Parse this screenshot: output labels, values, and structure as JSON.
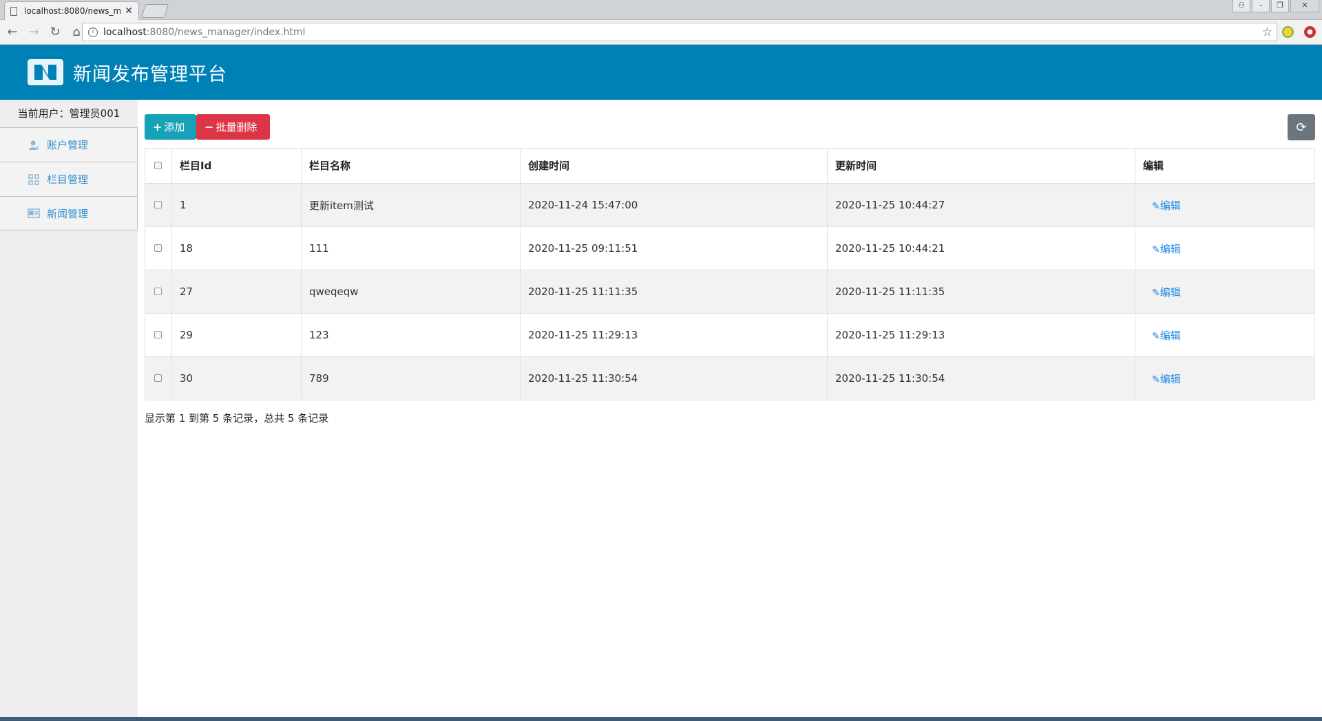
{
  "browser": {
    "tab_title": "localhost:8080/news_m",
    "url_host": "localhost",
    "url_path": ":8080/news_manager/index.html"
  },
  "app": {
    "title": "新闻发布管理平台",
    "brand_color": "#0081b6"
  },
  "sidebar": {
    "current_user": "当前用户：管理员001",
    "items": [
      {
        "label": "账户管理",
        "icon": "user-icon"
      },
      {
        "label": "栏目管理",
        "icon": "grid-icon"
      },
      {
        "label": "新闻管理",
        "icon": "news-icon"
      }
    ]
  },
  "toolbar": {
    "add_label": "添加",
    "batch_delete_label": "批量删除"
  },
  "table": {
    "headers": [
      "栏目Id",
      "栏目名称",
      "创建时间",
      "更新时间",
      "编辑"
    ],
    "edit_label": "编辑",
    "rows": [
      {
        "id": "1",
        "name": "更新item测试",
        "created": "2020-11-24 15:47:00",
        "updated": "2020-11-25 10:44:27"
      },
      {
        "id": "18",
        "name": "111",
        "created": "2020-11-25 09:11:51",
        "updated": "2020-11-25 10:44:21"
      },
      {
        "id": "27",
        "name": "qweqeqw",
        "created": "2020-11-25 11:11:35",
        "updated": "2020-11-25 11:11:35"
      },
      {
        "id": "29",
        "name": "123",
        "created": "2020-11-25 11:29:13",
        "updated": "2020-11-25 11:29:13"
      },
      {
        "id": "30",
        "name": "789",
        "created": "2020-11-25 11:30:54",
        "updated": "2020-11-25 11:30:54"
      }
    ]
  },
  "pagination": {
    "summary": "显示第 1 到第 5 条记录，总共 5 条记录"
  }
}
